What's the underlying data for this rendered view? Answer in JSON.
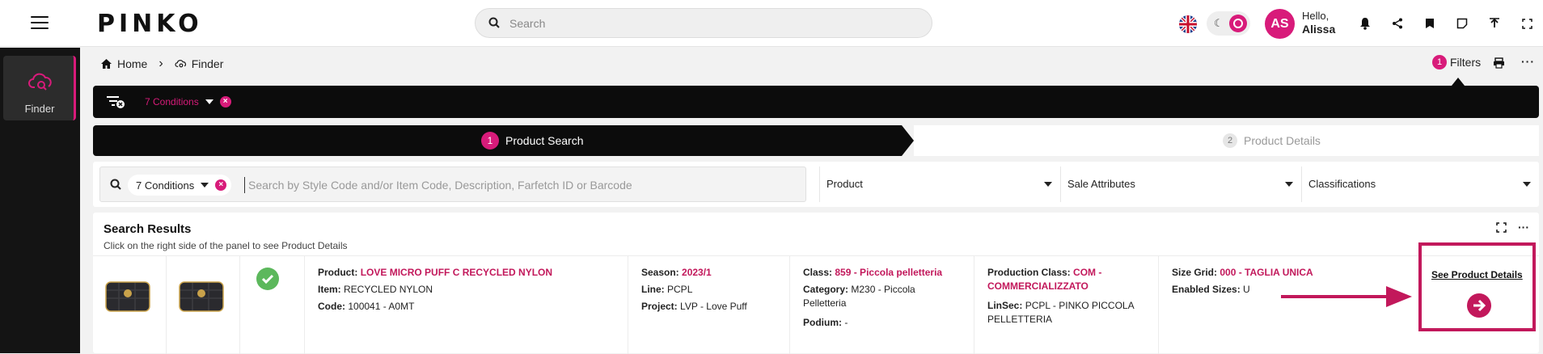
{
  "header": {
    "brand": "PINKO",
    "search_placeholder": "Search",
    "user_initials": "AS",
    "greeting": "Hello,",
    "user_name": "Alissa"
  },
  "sidebar": {
    "finder_label": "Finder"
  },
  "breadcrumb": {
    "home": "Home",
    "current": "Finder"
  },
  "toolbar": {
    "filters_count": "1",
    "filters_label": "Filters"
  },
  "conditions_bar": {
    "label": "7 Conditions"
  },
  "steps": [
    {
      "num": "1",
      "label": "Product Search"
    },
    {
      "num": "2",
      "label": "Product Details"
    }
  ],
  "search": {
    "chip_label": "7 Conditions",
    "placeholder": "Search by Style Code and/or Item Code, Description, Farfetch ID or Barcode",
    "dropdowns": [
      "Product",
      "Sale Attributes",
      "Classifications"
    ]
  },
  "results": {
    "title": "Search Results",
    "subtitle": "Click on the right side of the panel to see Product Details",
    "row": {
      "product_label": "Product:",
      "product_value": "LOVE MICRO PUFF C RECYCLED NYLON",
      "item_label": "Item:",
      "item_value": "RECYCLED NYLON",
      "code_label": "Code:",
      "code_value": "100041 - A0MT",
      "season_label": "Season:",
      "season_value": "2023/1",
      "line_label": "Line:",
      "line_value": "PCPL",
      "project_label": "Project:",
      "project_value": "LVP - Love Puff",
      "class_label": "Class:",
      "class_value": "859 - Piccola pelletteria",
      "category_label": "Category:",
      "category_value": "M230 - Piccola Pelletteria",
      "podium_label": "Podium:",
      "podium_value": "-",
      "prodclass_label": "Production Class:",
      "prodclass_value": "COM - COMMERCIALIZZATO",
      "linsec_label": "LinSec:",
      "linsec_value": "PCPL - PINKO PICCOLA PELLETTERIA",
      "sizegrid_label": "Size Grid:",
      "sizegrid_value": "000 - TAGLIA UNICA",
      "enabled_label": "Enabled Sizes:",
      "enabled_value": "U",
      "see_details": "See Product Details"
    }
  },
  "colors": {
    "accent": "#d81b7a",
    "dark": "#0c0c0c"
  }
}
